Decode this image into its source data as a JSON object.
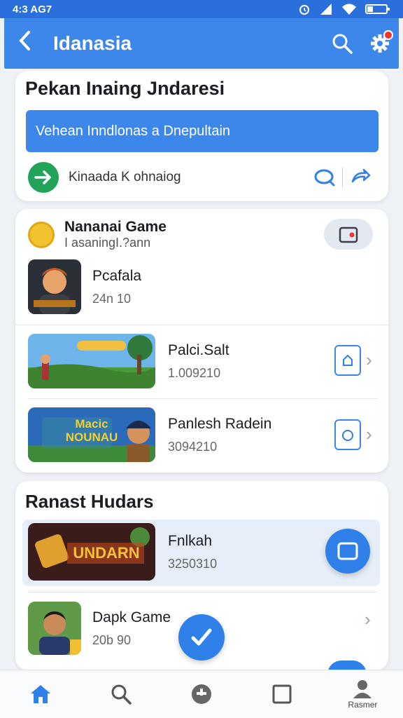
{
  "status": {
    "time": "4:3 AG7"
  },
  "appbar": {
    "title": "Idanasia",
    "back_icon": "chevron-left-icon",
    "search_icon": "search-icon",
    "settings_icon": "gear-icon"
  },
  "card1": {
    "title": "Pekan Inaing Jndaresi",
    "banner": "Vehean Inndlonas a  Dnepultain",
    "row_text": "Kinaada K ohnaiog"
  },
  "card2": {
    "title": "Nananai Game",
    "subtitle": "I asaningI.?ann",
    "items": [
      {
        "name": "Pcafala",
        "value": "24n 10"
      },
      {
        "name": "Palci.Salt",
        "value": "1.009210"
      },
      {
        "name": "Panlesh Radein",
        "value": "3094210"
      }
    ],
    "thumb_text_2": "Macic NOUNAU"
  },
  "card3": {
    "title": "Ranast Hudars",
    "items": [
      {
        "name": "Fnlkah",
        "value": "3250310"
      },
      {
        "name": "Dapk Game",
        "value": "20b 90"
      }
    ],
    "thumb_text_1": "UNDARN"
  },
  "bottomnav": {
    "profile_label": "Rasmer"
  },
  "colors": {
    "primary": "#3d86ea",
    "green": "#22a35a"
  }
}
